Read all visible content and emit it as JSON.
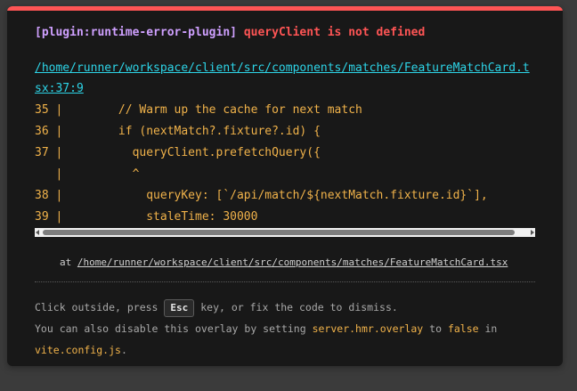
{
  "error": {
    "plugin": "[plugin:runtime-error-plugin]",
    "message": "queryClient is not defined",
    "file_link": "/home/runner/workspace/client/src/components/matches/FeatureMatchCard.tsx:37:9"
  },
  "code_frame": {
    "lines": [
      "35 |        // Warm up the cache for next match",
      "36 |        if (nextMatch?.fixture?.id) {",
      "37 |          queryClient.prefetchQuery({",
      "   |          ^",
      "38 |            queryKey: [`/api/match/${nextMatch.fixture.id}`],",
      "39 |            staleTime: 30000"
    ]
  },
  "stack": {
    "prefix": "at",
    "path": "/home/runner/workspace/client/src/components/matches/FeatureMatchCard.tsx"
  },
  "tip": {
    "line1_before": "Click outside, press",
    "key": "Esc",
    "line1_after": "key, or fix the code to dismiss.",
    "line2_before": "You can also disable this overlay by setting",
    "setting": "server.hmr.overlay",
    "line2_mid": "to",
    "value": "false",
    "line2_after": "in",
    "config_file": "vite.config.js",
    "config_suffix": "."
  },
  "colors": {
    "accent_bar": "#ff5555",
    "plugin": "#cfa0ff",
    "error": "#ff5555",
    "link": "#2dd4e7",
    "code": "#f0b24a"
  }
}
